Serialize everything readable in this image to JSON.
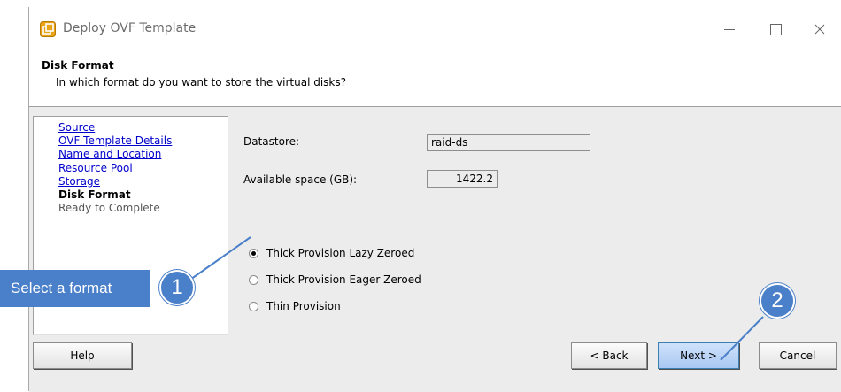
{
  "window": {
    "title": "Deploy OVF Template"
  },
  "header": {
    "title": "Disk Format",
    "subtitle": "In which format do you want to store the virtual disks?"
  },
  "steps": [
    {
      "label": "Source",
      "state": "done"
    },
    {
      "label": "OVF Template Details",
      "state": "done"
    },
    {
      "label": "Name and Location",
      "state": "done"
    },
    {
      "label": "Resource Pool",
      "state": "done"
    },
    {
      "label": "Storage",
      "state": "done"
    },
    {
      "label": "Disk Format",
      "state": "current"
    },
    {
      "label": "Ready to Complete",
      "state": "pending"
    }
  ],
  "datastore": {
    "label": "Datastore:",
    "value": "raid-ds"
  },
  "available_space": {
    "label": "Available space (GB):",
    "value": "1422.2"
  },
  "formats": {
    "selected": "Thick Provision Lazy Zeroed",
    "options": [
      "Thick Provision Lazy Zeroed",
      "Thick Provision Eager Zeroed",
      "Thin Provision"
    ]
  },
  "buttons": {
    "help": "Help",
    "back": "< Back",
    "next": "Next >",
    "cancel": "Cancel"
  },
  "annotations": {
    "callout_text": "Select a format",
    "marker_1": "1",
    "marker_2": "2"
  },
  "colors": {
    "callout": "#4a7fc9",
    "link": "#0000cc"
  }
}
